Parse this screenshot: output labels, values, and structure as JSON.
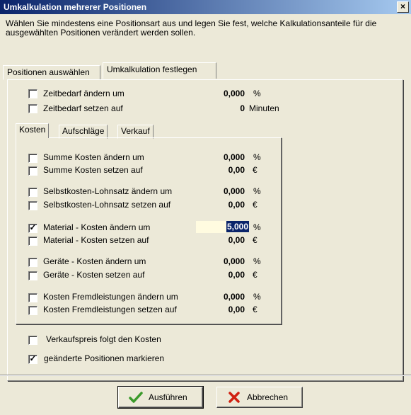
{
  "window": {
    "title": "Umkalkulation mehrerer Positionen",
    "close_label": "×"
  },
  "description": "Wählen Sie mindestens eine Positionsart aus und legen Sie fest, welche Kalkulationsanteile für die ausgewählten Positionen verändert werden sollen.",
  "tabs": [
    {
      "label": "Positionen auswählen",
      "active": false
    },
    {
      "label": "Umkalkulation festlegen",
      "active": true
    }
  ],
  "time": {
    "change_label": "Zeitbedarf ändern um",
    "change_value": "0,000",
    "change_unit": "%",
    "change_checked": false,
    "set_label": "Zeitbedarf setzen auf",
    "set_value": "0",
    "set_unit": "Minuten",
    "set_checked": false
  },
  "inner_tabs": [
    {
      "label": "Kosten",
      "active": true
    },
    {
      "label": "Aufschläge",
      "active": false
    },
    {
      "label": "Verkauf",
      "active": false
    }
  ],
  "cost_rows": [
    {
      "label": "Summe Kosten ändern um",
      "value": "0,000",
      "unit": "%",
      "checked": false
    },
    {
      "label": "Summe Kosten setzen auf",
      "value": "0,00",
      "unit": "€",
      "checked": false
    },
    {
      "label": "Selbstkosten-Lohnsatz ändern um",
      "value": "0,000",
      "unit": "%",
      "checked": false
    },
    {
      "label": "Selbstkosten-Lohnsatz setzen auf",
      "value": "0,00",
      "unit": "€",
      "checked": false
    },
    {
      "label": "Material - Kosten ändern um",
      "value": "5,000",
      "unit": "%",
      "checked": true
    },
    {
      "label": "Material - Kosten setzen auf",
      "value": "0,00",
      "unit": "€",
      "checked": false
    },
    {
      "label": "Geräte - Kosten ändern um",
      "value": "0,000",
      "unit": "%",
      "checked": false
    },
    {
      "label": "Geräte - Kosten setzen auf",
      "value": "0,00",
      "unit": "€",
      "checked": false
    },
    {
      "label": "Kosten Fremdleistungen ändern um",
      "value": "0,000",
      "unit": "%",
      "checked": false
    },
    {
      "label": "Kosten Fremdleistungen setzen auf",
      "value": "0,00",
      "unit": "€",
      "checked": false
    }
  ],
  "options": {
    "verkaufspreis_label": "Verkaufspreis folgt den Kosten",
    "verkaufspreis_checked": false,
    "markieren_label": "geänderte Positionen markieren",
    "markieren_checked": true
  },
  "buttons": {
    "execute_label": "Ausführen",
    "cancel_label": "Abbrechen"
  },
  "colors": {
    "title_start": "#0a246a",
    "title_end": "#a6caf0",
    "dialog_bg": "#ece9d8",
    "edit_bg": "#fffbe0",
    "ok_green": "#3a9a2a",
    "cancel_red": "#d02010"
  },
  "icons": {
    "execute": "checkmark-icon",
    "cancel": "x-icon"
  }
}
